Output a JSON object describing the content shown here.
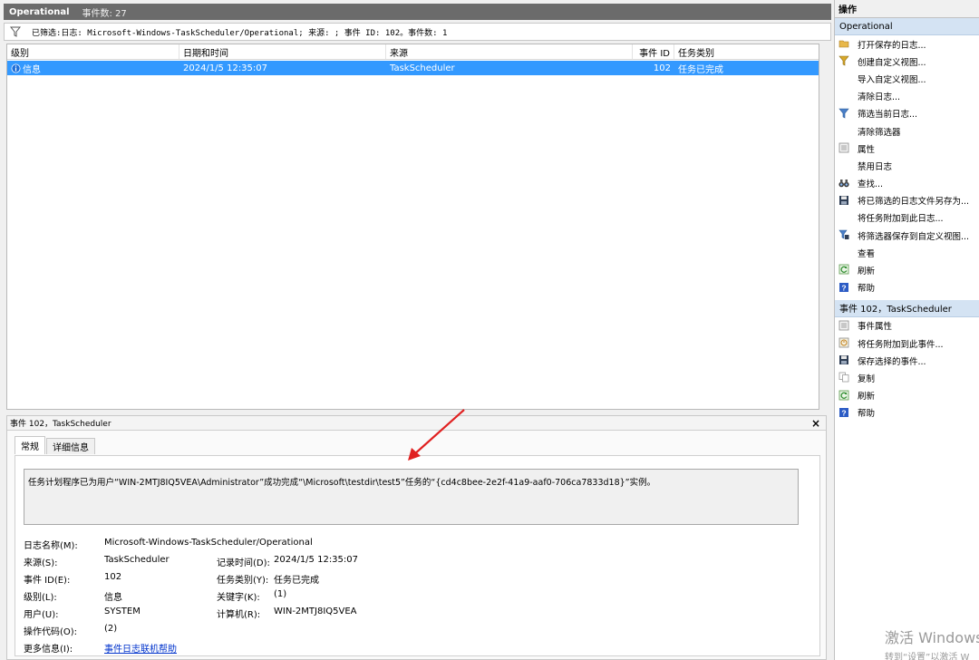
{
  "log_header": {
    "title": "Operational",
    "count": "事件数: 27"
  },
  "filter": {
    "text": "已筛选:日志: Microsoft-Windows-TaskScheduler/Operational; 来源: ; 事件 ID: 102。事件数: 1"
  },
  "grid": {
    "columns": [
      "级别",
      "日期和时间",
      "来源",
      "事件 ID",
      "任务类别"
    ],
    "rows": [
      {
        "level": "信息",
        "datetime": "2024/1/5 12:35:07",
        "source": "TaskScheduler",
        "event_id": "102",
        "category": "任务已完成"
      }
    ]
  },
  "detail": {
    "header": "事件 102，TaskScheduler",
    "close": "×",
    "tabs": [
      "常规",
      "详细信息"
    ],
    "description": "任务计划程序已为用户“WIN-2MTJ8IQ5VEA\\Administrator”成功完成“\\Microsoft\\testdir\\test5”任务的“{cd4c8bee-2e2f-41a9-aaf0-706ca7833d18}”实例。",
    "fields": {
      "log_name_label": "日志名称(M):",
      "log_name": "Microsoft-Windows-TaskScheduler/Operational",
      "source_label": "来源(S):",
      "source": "TaskScheduler",
      "logged_label": "记录时间(D):",
      "logged": "2024/1/5 12:35:07",
      "event_id_label": "事件 ID(E):",
      "event_id": "102",
      "category_label": "任务类别(Y):",
      "category": "任务已完成",
      "level_label": "级别(L):",
      "level": "信息",
      "keywords_label": "关键字(K):",
      "keywords": "(1)",
      "user_label": "用户(U):",
      "user": "SYSTEM",
      "computer_label": "计算机(R):",
      "computer": "WIN-2MTJ8IQ5VEA",
      "opcode_label": "操作代码(O):",
      "opcode": "(2)",
      "more_info_label": "更多信息(I):",
      "more_info": "事件日志联机帮助"
    }
  },
  "actions": {
    "title": "操作",
    "section1": {
      "title": "Operational",
      "items": [
        {
          "label": "打开保存的日志...",
          "icon": "folder-open-icon"
        },
        {
          "label": "创建自定义视图...",
          "icon": "filter-create-icon"
        },
        {
          "label": "导入自定义视图...",
          "icon": ""
        },
        {
          "label": "清除日志...",
          "icon": ""
        },
        {
          "label": "筛选当前日志...",
          "icon": "filter-icon"
        },
        {
          "label": "清除筛选器",
          "icon": ""
        },
        {
          "label": "属性",
          "icon": "properties-icon"
        },
        {
          "label": "禁用日志",
          "icon": ""
        },
        {
          "label": "查找...",
          "icon": "binoculars-icon"
        },
        {
          "label": "将已筛选的日志文件另存为...",
          "icon": "save-icon"
        },
        {
          "label": "将任务附加到此日志...",
          "icon": ""
        },
        {
          "label": "将筛选器保存到自定义视图...",
          "icon": "filter-save-icon"
        },
        {
          "label": "查看",
          "icon": ""
        },
        {
          "label": "刷新",
          "icon": "refresh-icon"
        },
        {
          "label": "帮助",
          "icon": "help-icon"
        }
      ]
    },
    "section2": {
      "title": "事件 102，TaskScheduler",
      "items": [
        {
          "label": "事件属性",
          "icon": "properties-icon"
        },
        {
          "label": "将任务附加到此事件...",
          "icon": "task-icon"
        },
        {
          "label": "保存选择的事件...",
          "icon": "save-icon"
        },
        {
          "label": "复制",
          "icon": "copy-icon"
        },
        {
          "label": "刷新",
          "icon": "refresh-icon"
        },
        {
          "label": "帮助",
          "icon": "help-icon"
        }
      ]
    }
  },
  "watermark": {
    "line1": "激活 Windows",
    "line2": "转到“设置”以激活 W"
  },
  "colors": {
    "selection": "#3399ff",
    "section_header": "#d4e3f3",
    "annotation_arrow": "#e02020"
  }
}
